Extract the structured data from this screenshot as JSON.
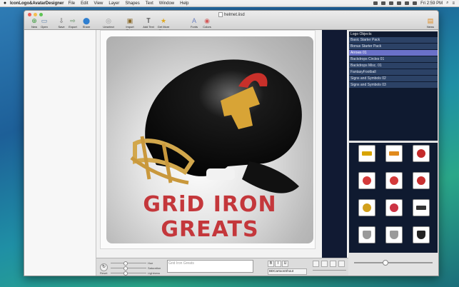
{
  "menubar": {
    "app": "IconLogo&AvatarDesigner",
    "items": [
      "File",
      "Edit",
      "View",
      "Layer",
      "Shapes",
      "Text",
      "Window",
      "Help"
    ],
    "clock": "Fri 2:59 PM"
  },
  "window": {
    "title": "helmet.iisd"
  },
  "toolbar": [
    {
      "label": "New",
      "icon": "plus-circle-icon",
      "color": "#3a9a3a"
    },
    {
      "label": "Open",
      "icon": "folder-icon",
      "color": "#5a7fa8"
    },
    {
      "label": "Save",
      "icon": "download-icon",
      "color": "#6a6a6a"
    },
    {
      "label": "Export",
      "icon": "export-icon",
      "color": "#5a8a5a"
    },
    {
      "label": "Share",
      "icon": "share-icon",
      "color": "#2f7fd0"
    },
    {
      "label": "Unselect",
      "icon": "unselect-icon",
      "color": "#9a9a9a"
    },
    {
      "label": "Import Photo",
      "icon": "photo-icon",
      "color": "#8a6a2a"
    },
    {
      "label": "Add Text",
      "icon": "text-icon",
      "color": "#111"
    },
    {
      "label": "Get More Objects",
      "icon": "star-icon",
      "color": "#e0a81c"
    },
    {
      "label": "Fonts",
      "icon": "fonts-icon",
      "color": "#6a7fbf"
    },
    {
      "label": "Colors",
      "icon": "colors-icon",
      "color": "#d45a5a"
    },
    {
      "label": "News",
      "icon": "news-icon",
      "color": "#e08a1c"
    }
  ],
  "logo": {
    "line1": "GRiD IRON",
    "line2": "GREATS",
    "text_color": "#c4373b"
  },
  "objects": {
    "header": "Logo Objects",
    "items": [
      "Basic Starter Pack",
      "Bonus Starter Pack",
      "Arrows 01",
      "Backdrops Circles 01",
      "Backdrops Misc. 01",
      "FantasyFootball",
      "Signs and Symbols 02",
      "Signs and Symbols 03"
    ],
    "selected_index": 2
  },
  "thumbs": [
    {
      "name": "tee-icon",
      "color": "#d8a400",
      "shape": "bar"
    },
    {
      "name": "goalpost-icon",
      "color": "#e08a1c",
      "shape": "bar"
    },
    {
      "name": "helmet-icon",
      "color": "#c42a2a",
      "shape": "circle"
    },
    {
      "name": "helmet-icon",
      "color": "#d43a3a",
      "shape": "circle"
    },
    {
      "name": "helmet-icon",
      "color": "#d43a3a",
      "shape": "circle"
    },
    {
      "name": "helmet-icon",
      "color": "#c83030",
      "shape": "circle"
    },
    {
      "name": "helmet-icon",
      "color": "#d2a01c",
      "shape": "circle"
    },
    {
      "name": "helmet-icon",
      "color": "#cc3344",
      "shape": "circle"
    },
    {
      "name": "scoreboard-icon",
      "color": "#333333",
      "shape": "bar"
    },
    {
      "name": "shield-icon",
      "color": "#9a9a9a",
      "shape": "shield"
    },
    {
      "name": "shield-icon",
      "color": "#9a9a9a",
      "shape": "shield"
    },
    {
      "name": "shield-icon",
      "color": "#222222",
      "shape": "shield"
    }
  ],
  "bottom": {
    "hue_label": "Hue",
    "saturation_label": "Saturation",
    "reset_label": "Reset",
    "lightness_label": "Lightness",
    "text_placeholder": "Grid Iron Greats",
    "font": "BDCartoonShout"
  }
}
